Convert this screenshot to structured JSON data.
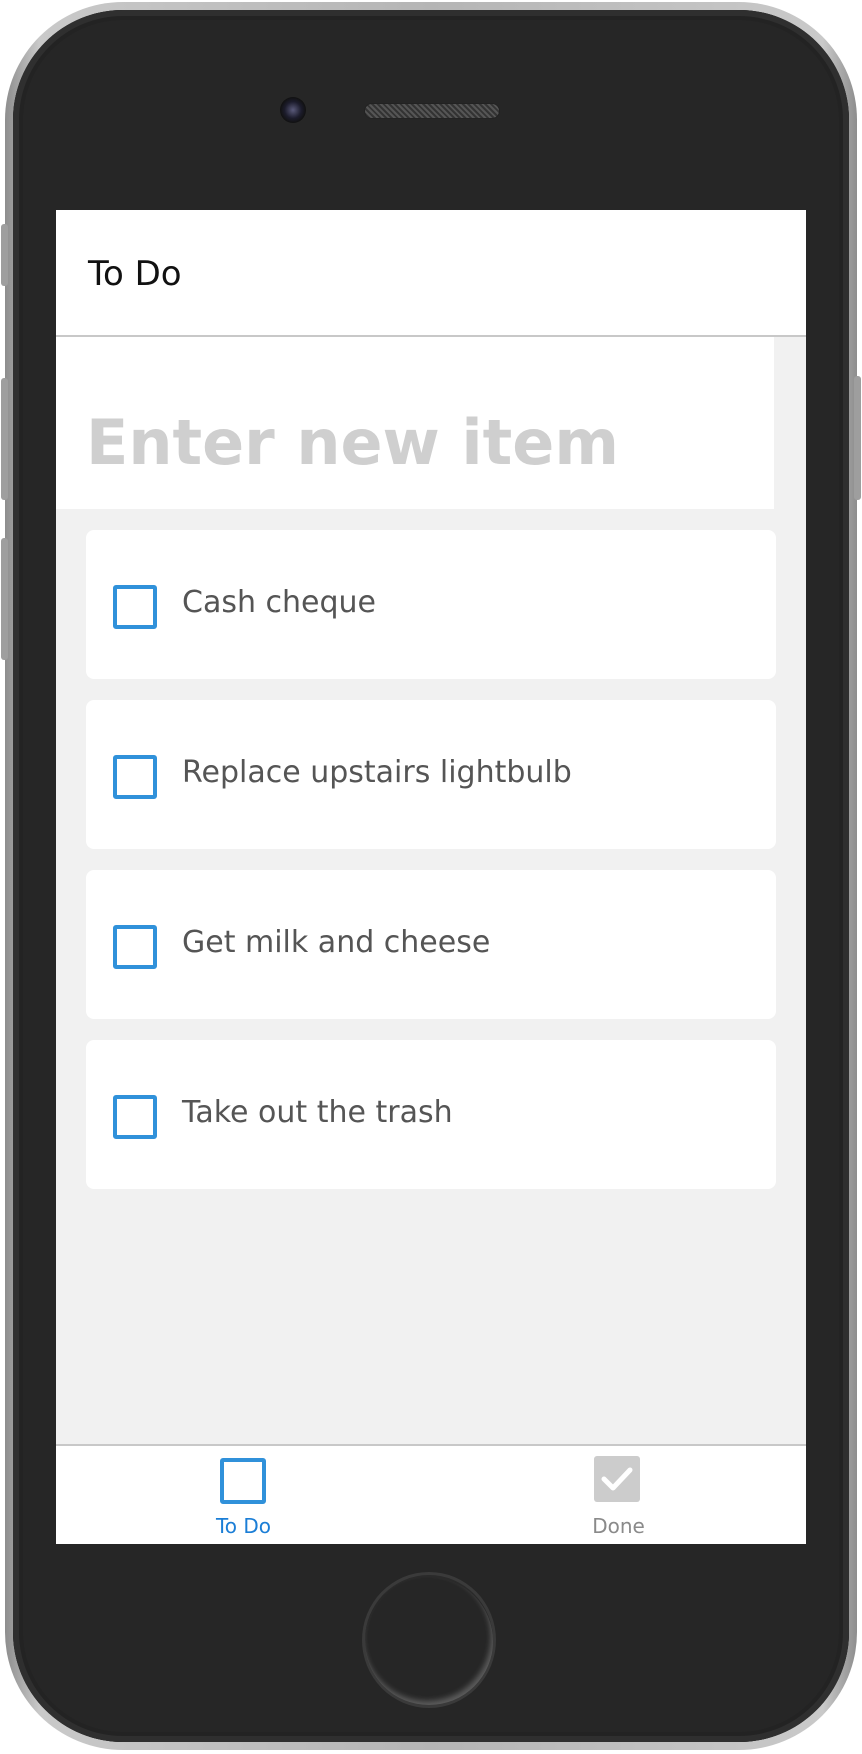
{
  "navbar": {
    "title": "To Do"
  },
  "new_item": {
    "placeholder": "Enter new item",
    "value": ""
  },
  "todo_items": [
    {
      "label": "Cash cheque",
      "checked": false
    },
    {
      "label": "Replace upstairs lightbulb",
      "checked": false
    },
    {
      "label": "Get milk and cheese",
      "checked": false
    },
    {
      "label": "Take out the trash",
      "checked": false
    }
  ],
  "tabbar": {
    "tabs": [
      {
        "label": "To Do",
        "icon": "checkbox-outline-icon",
        "active": true
      },
      {
        "label": "Done",
        "icon": "checkbox-checked-icon",
        "active": false
      }
    ]
  },
  "colors": {
    "accent": "#3091da",
    "tab_active": "#1b7ed6",
    "tab_inactive": "#8a8a8a",
    "item_text": "#555555",
    "placeholder": "#cfcfcf",
    "list_background": "#f1f1f1"
  }
}
